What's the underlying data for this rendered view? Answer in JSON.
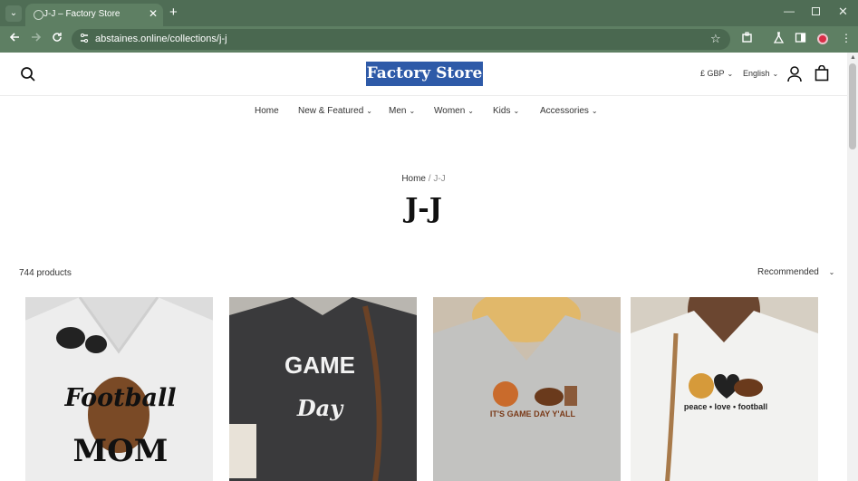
{
  "browser": {
    "tab_title": "J-J – Factory Store",
    "tab_close": "✕",
    "new_tab": "+",
    "url": "abstaines.online/collections/j-j",
    "window_min": "—",
    "window_close": "✕"
  },
  "header": {
    "logo_text": "Factory Store",
    "currency": "£ GBP",
    "language": "English"
  },
  "nav": {
    "items": [
      {
        "label": "Home"
      },
      {
        "label": "New & Featured"
      },
      {
        "label": "Men"
      },
      {
        "label": "Women"
      },
      {
        "label": "Kids"
      },
      {
        "label": "Accessories"
      }
    ]
  },
  "collection": {
    "breadcrumb_home": "Home",
    "breadcrumb_sep": "/",
    "breadcrumb_current": "J-J",
    "title": "J-J",
    "product_count": "744 products",
    "sort_label": "Recommended"
  },
  "products": [
    {
      "print_line1": "Football",
      "print_line2": "MOM",
      "color": "#dcdcdc"
    },
    {
      "print_line1": "GAME",
      "print_line2": "Day",
      "color": "#3a3a3c"
    },
    {
      "print_line1": "IT'S GAME DAY Y'ALL",
      "color": "#c2c2c0"
    },
    {
      "print_line1": "peace • love • football",
      "color": "#f2f2f0"
    }
  ]
}
